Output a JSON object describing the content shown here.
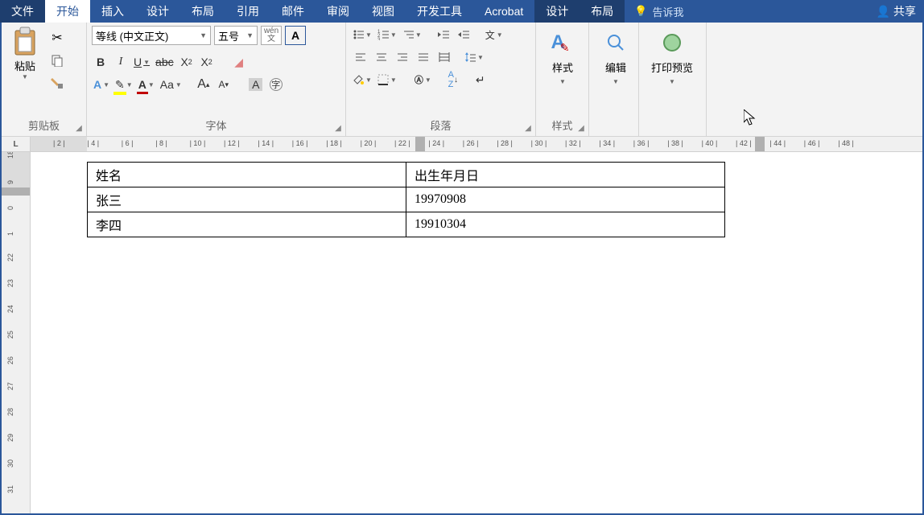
{
  "menu": {
    "file": "文件",
    "home": "开始",
    "insert": "插入",
    "design": "设计",
    "layout": "布局",
    "references": "引用",
    "mail": "邮件",
    "review": "审阅",
    "view": "视图",
    "developer": "开发工具",
    "acrobat": "Acrobat",
    "design2": "设计",
    "layout2": "布局",
    "tellme": "告诉我",
    "share": "共享"
  },
  "ribbon": {
    "clipboard": {
      "label": "剪贴板",
      "paste": "粘贴"
    },
    "font": {
      "label": "字体",
      "font_name": "等线 (中文正文)",
      "font_size": "五号",
      "wen": "wén",
      "wen_sub": "文",
      "A": "A"
    },
    "paragraph": {
      "label": "段落"
    },
    "styles": {
      "label": "样式",
      "btn": "样式"
    },
    "editing": {
      "btn": "编辑"
    },
    "print_preview": {
      "btn": "打印预览"
    }
  },
  "ruler_corner": "L",
  "table": {
    "headers": [
      "姓名",
      "出生年月日"
    ],
    "rows": [
      [
        "张三",
        "19970908"
      ],
      [
        "李四",
        "19910304"
      ]
    ]
  }
}
